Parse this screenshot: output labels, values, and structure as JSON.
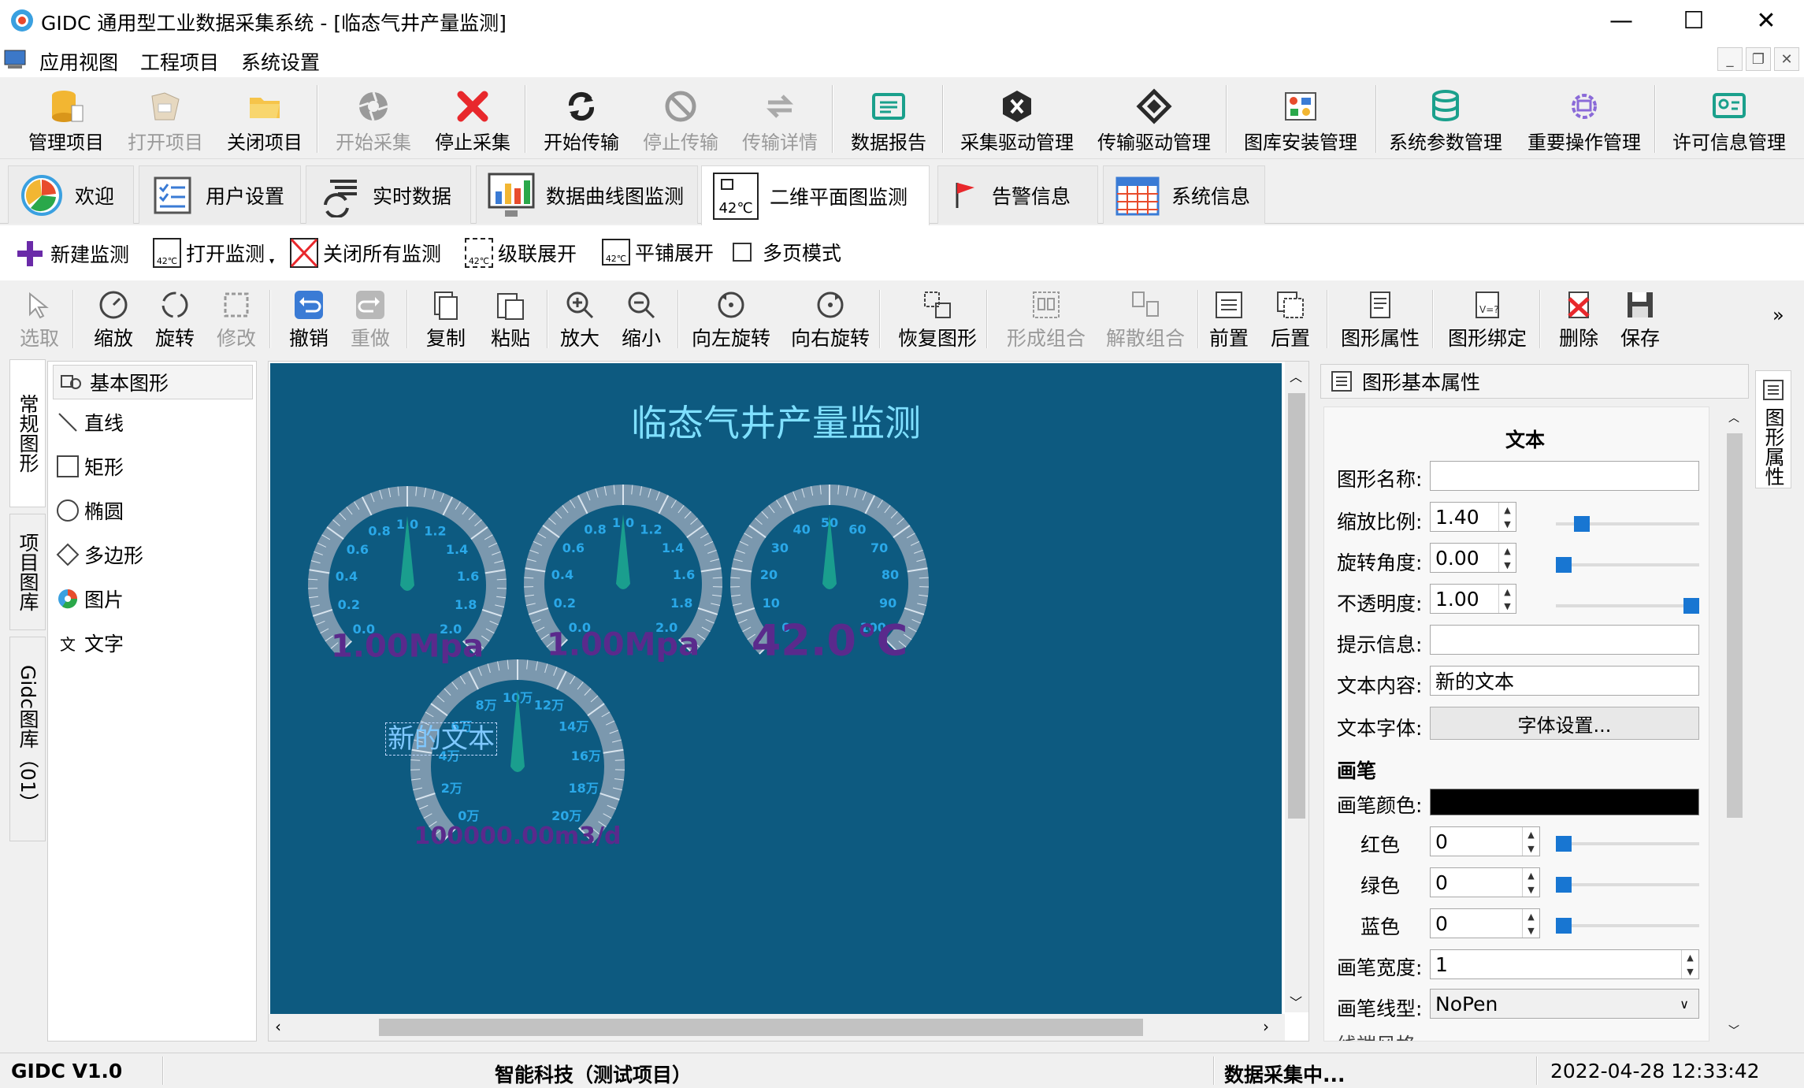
{
  "window": {
    "title": "GIDC 通用型工业数据采集系统 - [临态气井产量监测]",
    "min_glyph": "—",
    "max_glyph": "☐",
    "close_glyph": "✕"
  },
  "menu": [
    "应用视图",
    "工程项目",
    "系统设置"
  ],
  "mdi_buttons": [
    "_",
    "❐",
    "✕"
  ],
  "toolbar": [
    {
      "label": "管理项目",
      "icon": "database-icon"
    },
    {
      "label": "打开项目",
      "icon": "open-project-icon",
      "disabled": true
    },
    {
      "label": "关闭项目",
      "icon": "folder-icon"
    },
    {
      "label": "开始采集",
      "icon": "aperture-icon",
      "disabled": true
    },
    {
      "label": "停止采集",
      "icon": "red-x-icon"
    },
    {
      "label": "开始传输",
      "icon": "sync-icon"
    },
    {
      "label": "停止传输",
      "icon": "stop-icon",
      "disabled": true
    },
    {
      "label": "传输详情",
      "icon": "transfer-icon",
      "disabled": true
    },
    {
      "label": "数据报告",
      "icon": "report-icon"
    },
    {
      "label": "采集驱动管理",
      "icon": "x-hexagon-icon"
    },
    {
      "label": "传输驱动管理",
      "icon": "diamond-icon"
    },
    {
      "label": "图库安装管理",
      "icon": "library-icon"
    },
    {
      "label": "系统参数管理",
      "icon": "db-settings-icon"
    },
    {
      "label": "重要操作管理",
      "icon": "gear-icon"
    },
    {
      "label": "许可信息管理",
      "icon": "license-icon"
    }
  ],
  "tabs": [
    {
      "label": "欢迎",
      "icon": "welcome-icon"
    },
    {
      "label": "用户设置",
      "icon": "user-settings-icon"
    },
    {
      "label": "实时数据",
      "icon": "realtime-icon"
    },
    {
      "label": "数据曲线图监测",
      "icon": "chart-monitor-icon"
    },
    {
      "label": "二维平面图监测",
      "icon": "temperature-icon",
      "active": true
    },
    {
      "label": "告警信息",
      "icon": "alarm-flag-icon"
    },
    {
      "label": "系统信息",
      "icon": "calendar-icon"
    }
  ],
  "subbar": {
    "new_monitor": "新建监测",
    "open_monitor": "打开监测",
    "close_all": "关闭所有监测",
    "cascade": "级联展开",
    "tile": "平铺展开",
    "multipage": "多页模式",
    "icon_text": "42℃"
  },
  "editbar": [
    {
      "label": "选取",
      "icon": "select-icon",
      "disabled": true
    },
    {
      "label": "缩放",
      "icon": "zoom-gauge-icon"
    },
    {
      "label": "旋转",
      "icon": "rotate-icon"
    },
    {
      "label": "修改",
      "icon": "edit-icon",
      "disabled": true
    },
    {
      "label": "撤销",
      "icon": "undo-icon"
    },
    {
      "label": "重做",
      "icon": "redo-icon",
      "disabled": true
    },
    {
      "label": "复制",
      "icon": "copy-icon"
    },
    {
      "label": "粘贴",
      "icon": "paste-icon"
    },
    {
      "label": "放大",
      "icon": "zoom-in-icon"
    },
    {
      "label": "缩小",
      "icon": "zoom-out-icon"
    },
    {
      "label": "向左旋转",
      "icon": "rotate-left-icon"
    },
    {
      "label": "向右旋转",
      "icon": "rotate-right-icon"
    },
    {
      "label": "恢复图形",
      "icon": "restore-icon"
    },
    {
      "label": "形成组合",
      "icon": "group-icon",
      "disabled": true
    },
    {
      "label": "解散组合",
      "icon": "ungroup-icon",
      "disabled": true
    },
    {
      "label": "前置",
      "icon": "bring-front-icon"
    },
    {
      "label": "后置",
      "icon": "send-back-icon"
    },
    {
      "label": "图形属性",
      "icon": "properties-icon"
    },
    {
      "label": "图形绑定",
      "icon": "bind-icon"
    },
    {
      "label": "删除",
      "icon": "delete-icon"
    },
    {
      "label": "保存",
      "icon": "save-icon"
    }
  ],
  "editbar_more": "»",
  "left_tabs": [
    "常规图形",
    "项目图库",
    "Gidc图库（01）"
  ],
  "shape_panel": {
    "header": "基本图形",
    "items": [
      "直线",
      "矩形",
      "椭圆",
      "多边形",
      "图片",
      "文字"
    ]
  },
  "canvas": {
    "title": "临态气井产量监测",
    "text_item": "新的文本",
    "gauges": [
      {
        "ticks": [
          "0.0",
          "0.2",
          "0.4",
          "0.6",
          "0.8",
          "1.0",
          "1.2",
          "1.4",
          "1.6",
          "1.8",
          "2.0"
        ],
        "value": 1.0,
        "readout": "1.00Mpa",
        "value_fraction": 0.5
      },
      {
        "ticks": [
          "0.0",
          "0.2",
          "0.4",
          "0.6",
          "0.8",
          "1.0",
          "1.2",
          "1.4",
          "1.6",
          "1.8",
          "2.0"
        ],
        "value": 1.0,
        "readout": "1.00Mpa",
        "value_fraction": 0.5
      },
      {
        "ticks": [
          "0",
          "10",
          "20",
          "30",
          "40",
          "50",
          "60",
          "70",
          "80",
          "90",
          "100"
        ],
        "value": 42.0,
        "readout": "42.0℃",
        "value_fraction": 0.5
      },
      {
        "ticks": [
          "0万",
          "2万",
          "4万",
          "6万",
          "8万",
          "10万",
          "12万",
          "14万",
          "16万",
          "18万",
          "20万"
        ],
        "value": 100000,
        "readout": "100000.00m3/d",
        "value_fraction": 0.5
      }
    ],
    "colors": {
      "background": "#0d5a80",
      "title": "#7fe0ff",
      "arc": "#7b98ae",
      "tick_label": "#2aa8e8",
      "needle": "#1a9e8e",
      "readout": "#5a2a8c"
    }
  },
  "props": {
    "header": "图形基本属性",
    "section_text": "文本",
    "name_label": "图形名称:",
    "name_value": "",
    "scale_label": "缩放比例:",
    "scale_value": "1.40",
    "rotate_label": "旋转角度:",
    "rotate_value": "0.00",
    "opacity_label": "不透明度:",
    "opacity_value": "1.00",
    "tip_label": "提示信息:",
    "tip_value": "",
    "content_label": "文本内容:",
    "content_value": "新的文本",
    "font_label": "文本字体:",
    "font_button": "字体设置...",
    "section_pen": "画笔",
    "pen_color_label": "画笔颜色:",
    "pen_color": "#000000",
    "red_label": "红色",
    "red_value": "0",
    "green_label": "绿色",
    "green_value": "0",
    "blue_label": "蓝色",
    "blue_value": "0",
    "width_label": "画笔宽度:",
    "width_value": "1",
    "style_label": "画笔线型:",
    "style_value": "NoPen",
    "cap_label": "线端风格:",
    "scale_fraction": 0.14,
    "rotate_fraction": 0.0,
    "opacity_fraction": 1.0
  },
  "right_tab": "图形属性",
  "status": {
    "version": "GIDC V1.0",
    "company": "智能科技（测试项目）",
    "state": "数据采集中...",
    "datetime": "2022-04-28 12:33:42"
  }
}
